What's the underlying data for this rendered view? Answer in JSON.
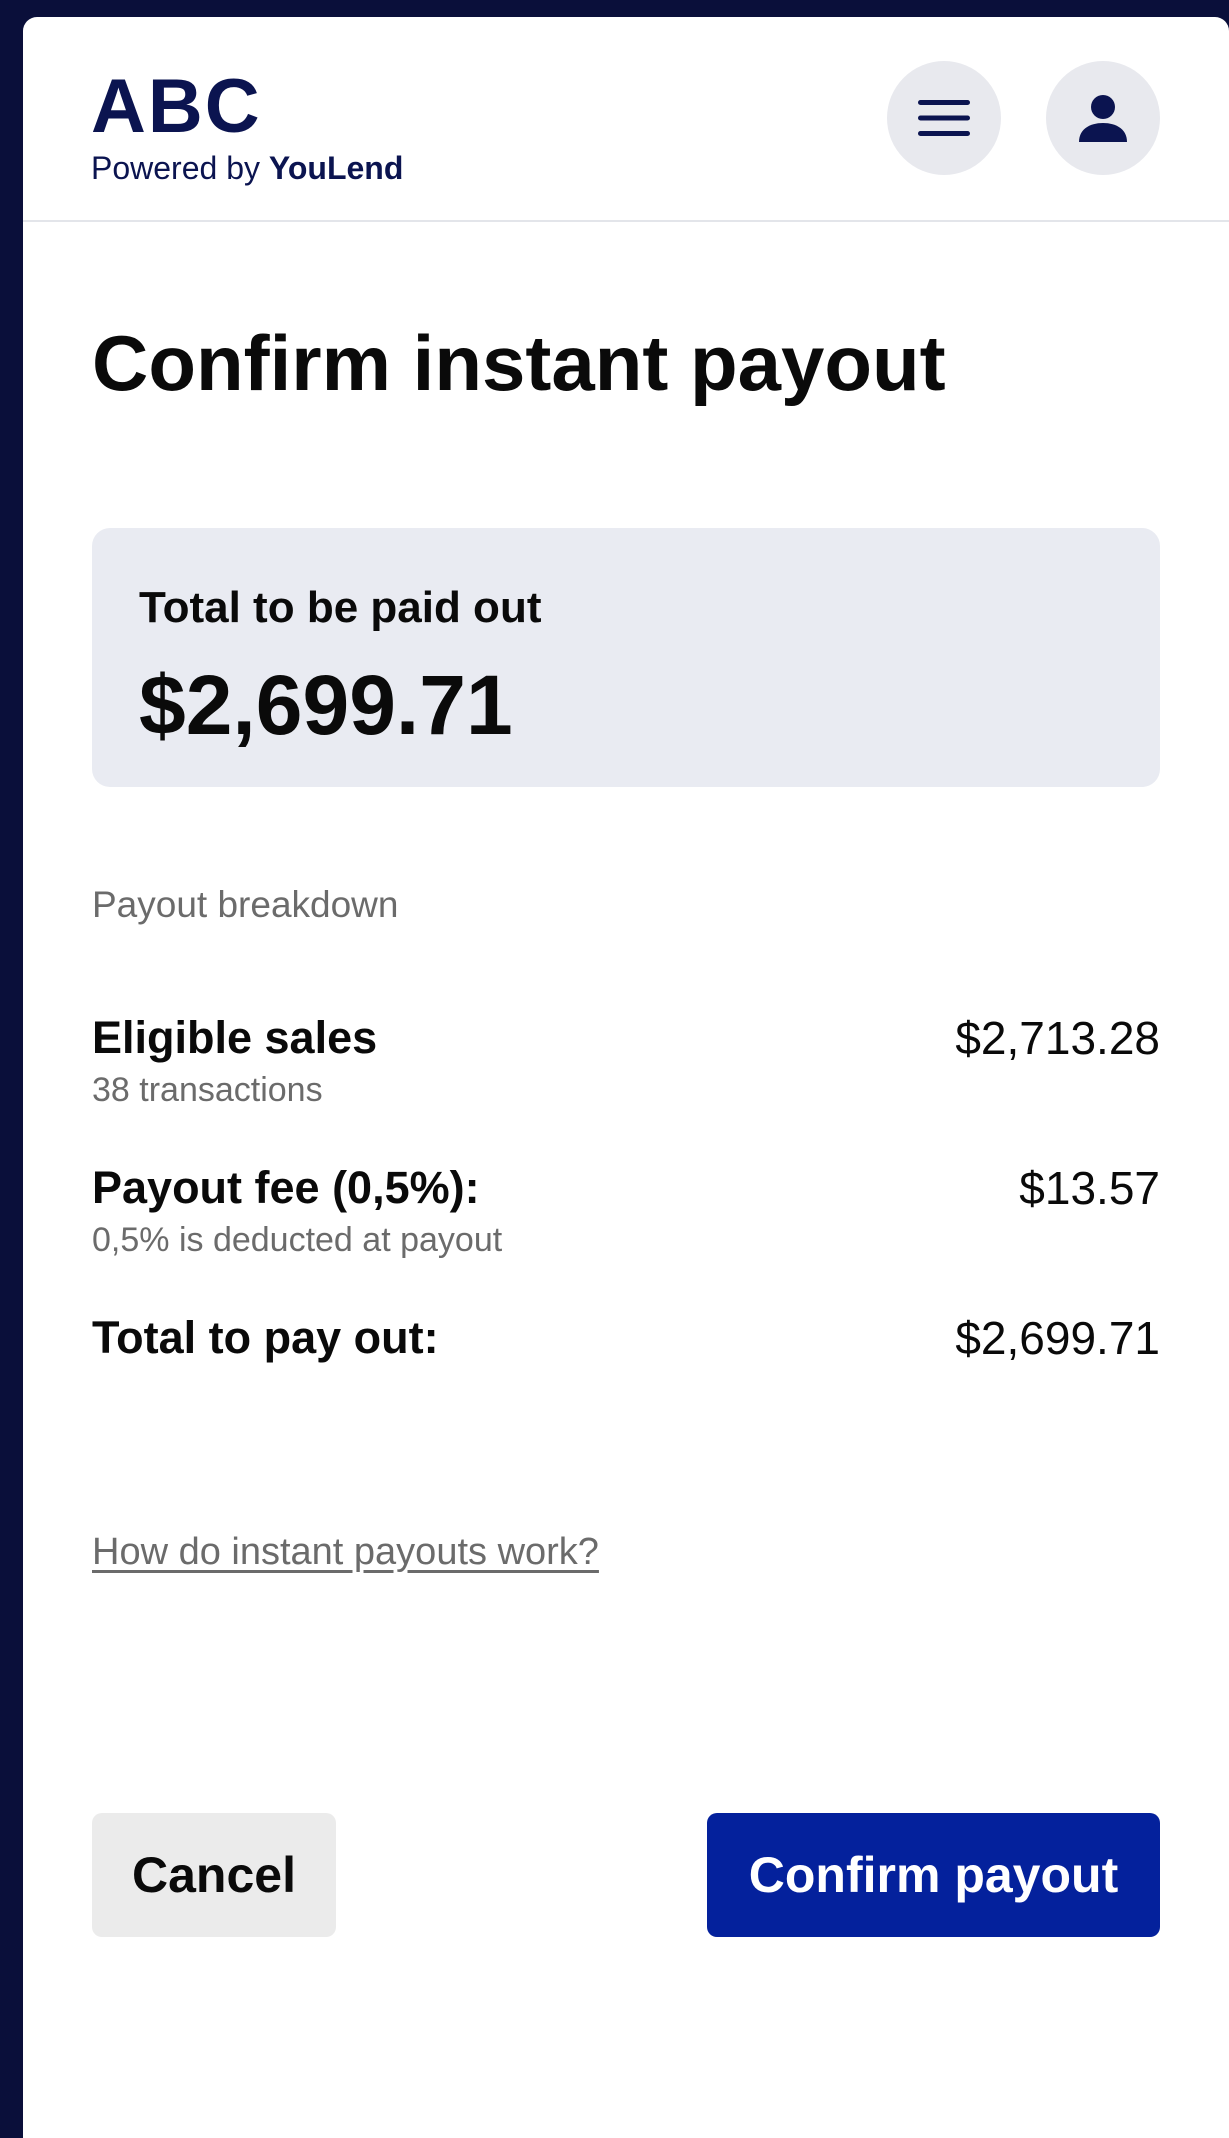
{
  "header": {
    "logo_text": "ABC",
    "powered_by": "Powered by",
    "powered_brand": "YouLend",
    "menu_icon": "menu-icon",
    "profile_icon": "user-icon"
  },
  "page": {
    "title": "Confirm instant payout"
  },
  "summary": {
    "label": "Total to be paid out",
    "amount": "$2,699.71"
  },
  "breakdown": {
    "heading": "Payout breakdown",
    "rows": [
      {
        "label": "Eligible sales",
        "sub": "38 transactions",
        "value": "$2,713.28"
      },
      {
        "label": "Payout fee (0,5%):",
        "sub": "0,5% is deducted at payout",
        "value": "$13.57"
      },
      {
        "label": "Total to pay out:",
        "sub": "",
        "value": "$2,699.71"
      }
    ]
  },
  "help_link": "How do instant payouts work?",
  "actions": {
    "cancel_label": "Cancel",
    "confirm_label": "Confirm payout"
  },
  "colors": {
    "brand_navy": "#0b1450",
    "primary_button": "#04219c",
    "summary_card": "#e9ebf2"
  }
}
